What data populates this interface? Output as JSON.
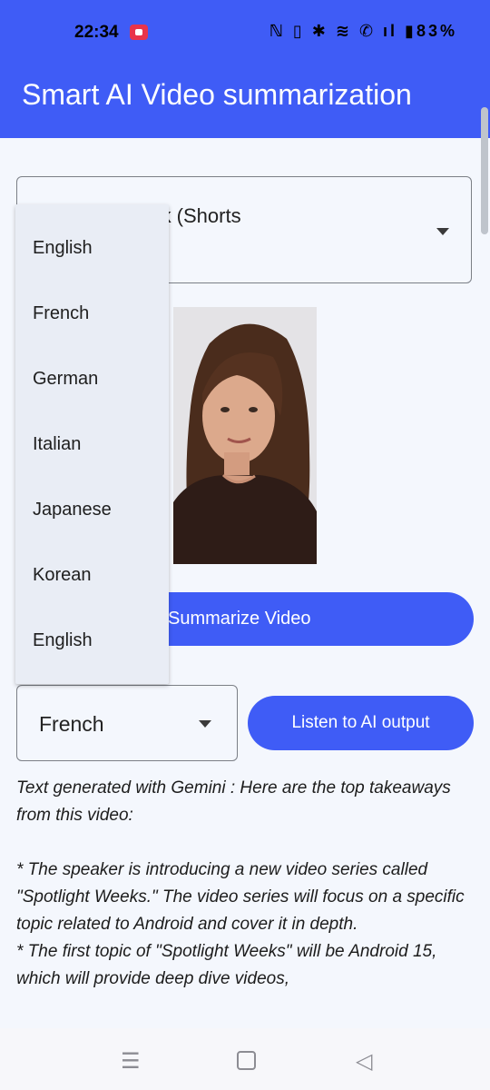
{
  "status_bar": {
    "time": "22:34",
    "icons": "ℕ ▯ ✱ ≋ ✆ ıl ▮",
    "battery": "83%"
  },
  "app_bar": {
    "title": "Smart AI Video summarization"
  },
  "video_selector": {
    "value": "Spotlight Week (Shorts"
  },
  "summarize_button": {
    "label": "Summarize Video"
  },
  "language_selector": {
    "value": "French"
  },
  "listen_button": {
    "label": "Listen to AI output"
  },
  "output": {
    "text": "Text generated with Gemini : Here are the top takeaways from this video:\n\n*  The speaker is introducing a new video series called \"Spotlight Weeks.\" The video series will focus on a specific topic related to Android and cover it in depth.\n*  The first topic of \"Spotlight Weeks\" will be Android 15, which will provide deep dive videos,"
  },
  "dropdown": {
    "items": [
      "English",
      "French",
      "German",
      "Italian",
      "Japanese",
      "Korean",
      "English"
    ]
  },
  "nav_bar": {
    "menu": "☰",
    "back": "◁"
  },
  "colors": {
    "primary": "#3f5cf6",
    "background": "#f4f7fd",
    "menu_bg": "#e9edf5"
  }
}
